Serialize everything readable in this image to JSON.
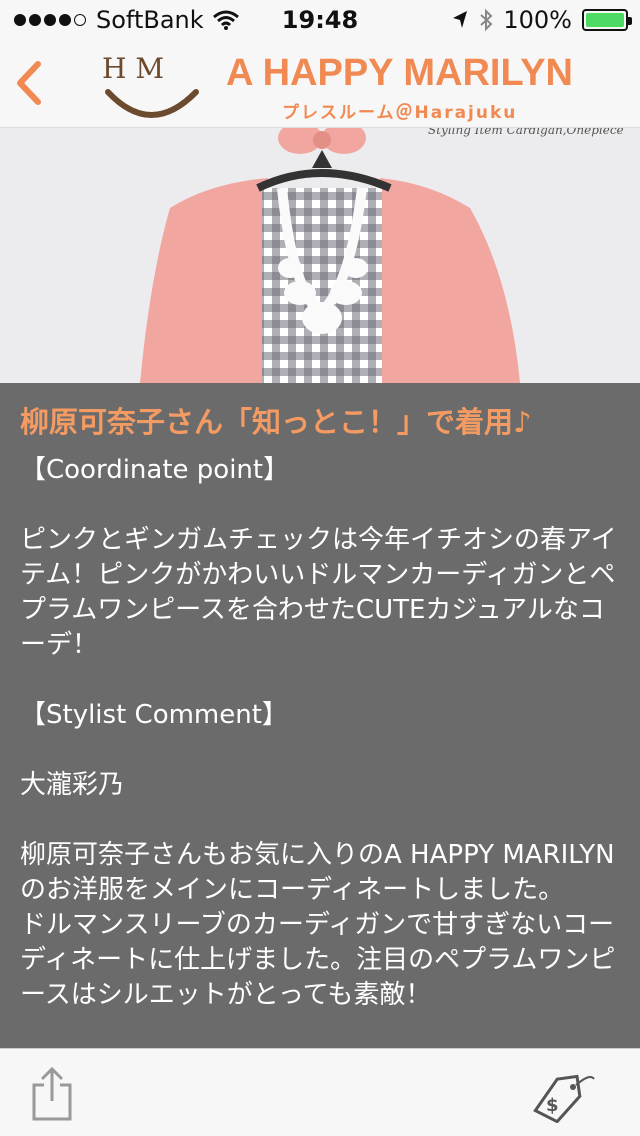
{
  "status_bar": {
    "carrier": "SoftBank",
    "time": "19:48",
    "battery": "100%",
    "battery_level": 1.0
  },
  "header": {
    "back_icon": "chevron-left-icon",
    "logo_letters": "H M",
    "title": "A HAPPY MARILYN",
    "subtitle": "プレスルーム＠Harajuku"
  },
  "photo": {
    "caption": "Styling Item  Cardigan,Onepiece"
  },
  "content": {
    "headline": "柳原可奈子さん「知っとこ！」で着用♪",
    "coordinate_heading": "【Coordinate point】",
    "coordinate_text": "ピンクとギンガムチェックは今年イチオシの春アイテム！ピンクがかわいいドルマンカーディガンとペプラムワンピースを合わせたCUTEカジュアルなコーデ！",
    "stylist_heading": "【Stylist Comment】",
    "stylist_name": "大瀧彩乃",
    "stylist_text_1": "柳原可奈子さんもお気に入りのA HAPPY MARILYNのお洋服をメインにコーディネートしました。",
    "stylist_text_2": "ドルマンスリーブのカーディガンで甘すぎないコーディネートに仕上げました。注目のペプラムワンピースはシルエットがとっても素敵！"
  },
  "toolbar": {
    "share_icon": "share-icon",
    "tag_icon": "price-tag-icon"
  },
  "colors": {
    "accent": "#f08a52",
    "headline": "#f49b63",
    "overlay": "#6b6b6b"
  }
}
